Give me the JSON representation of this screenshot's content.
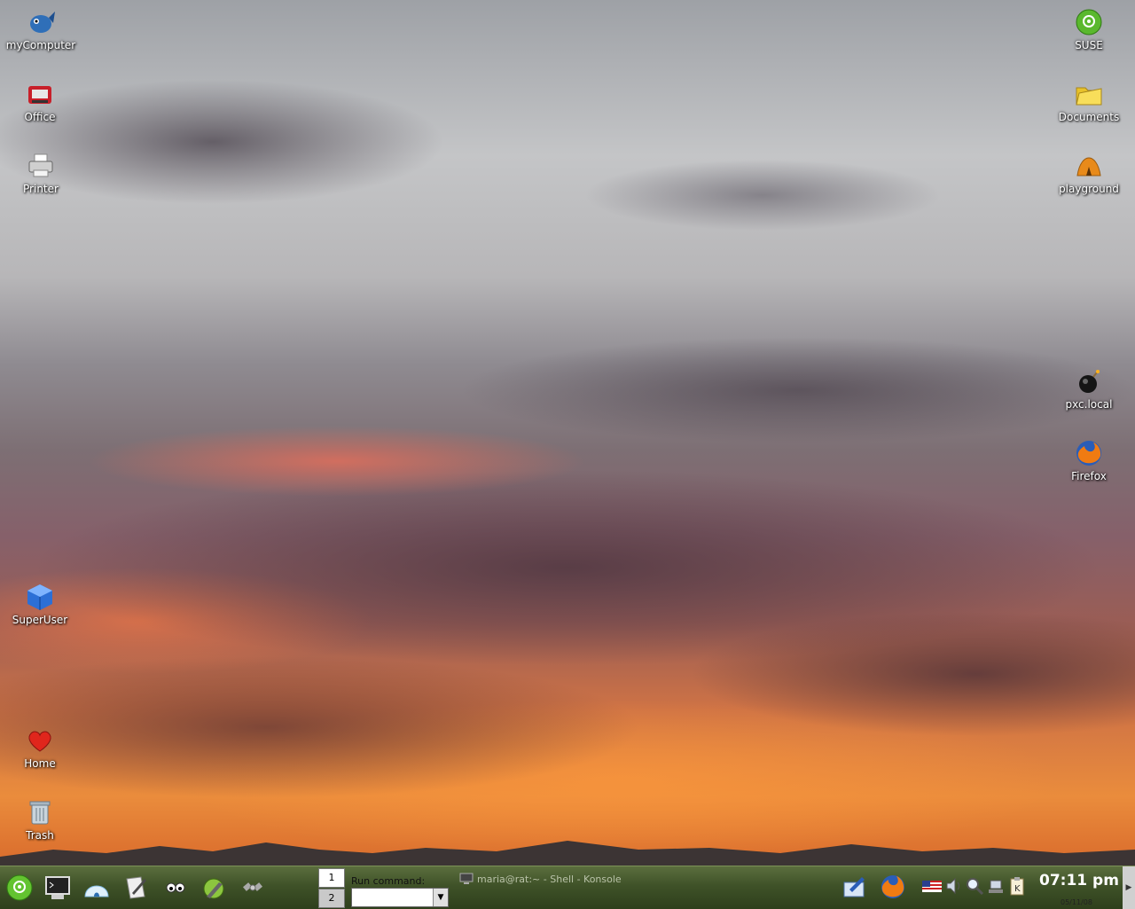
{
  "desktop": {
    "icons": {
      "mycomputer": "myComputer",
      "office": "Office",
      "printer": "Printer",
      "superuser": "SuperUser",
      "home": "Home",
      "trash": "Trash",
      "suse": "SUSE",
      "documents": "Documents",
      "playground": "playground",
      "pxc": "pxc.local",
      "firefox": "Firefox"
    }
  },
  "taskbar": {
    "launchers": [
      "suse-menu-icon",
      "terminal-icon",
      "igloo-icon",
      "writer-icon",
      "eyes-icon",
      "wrench-globe-icon",
      "satellite-icon"
    ],
    "pager": [
      "1",
      "2"
    ],
    "run_command_label": "Run command:",
    "task_title": "maria@rat:~ - Shell - Konsole",
    "tray": [
      "clipboard-edit-icon",
      "firefox-icon",
      "us-flag-icon",
      "speaker-icon",
      "search-icon",
      "network-icon",
      "klipper-icon"
    ],
    "clock": "07:11 pm",
    "date": "05/11/08",
    "accent": "#3f5228"
  }
}
